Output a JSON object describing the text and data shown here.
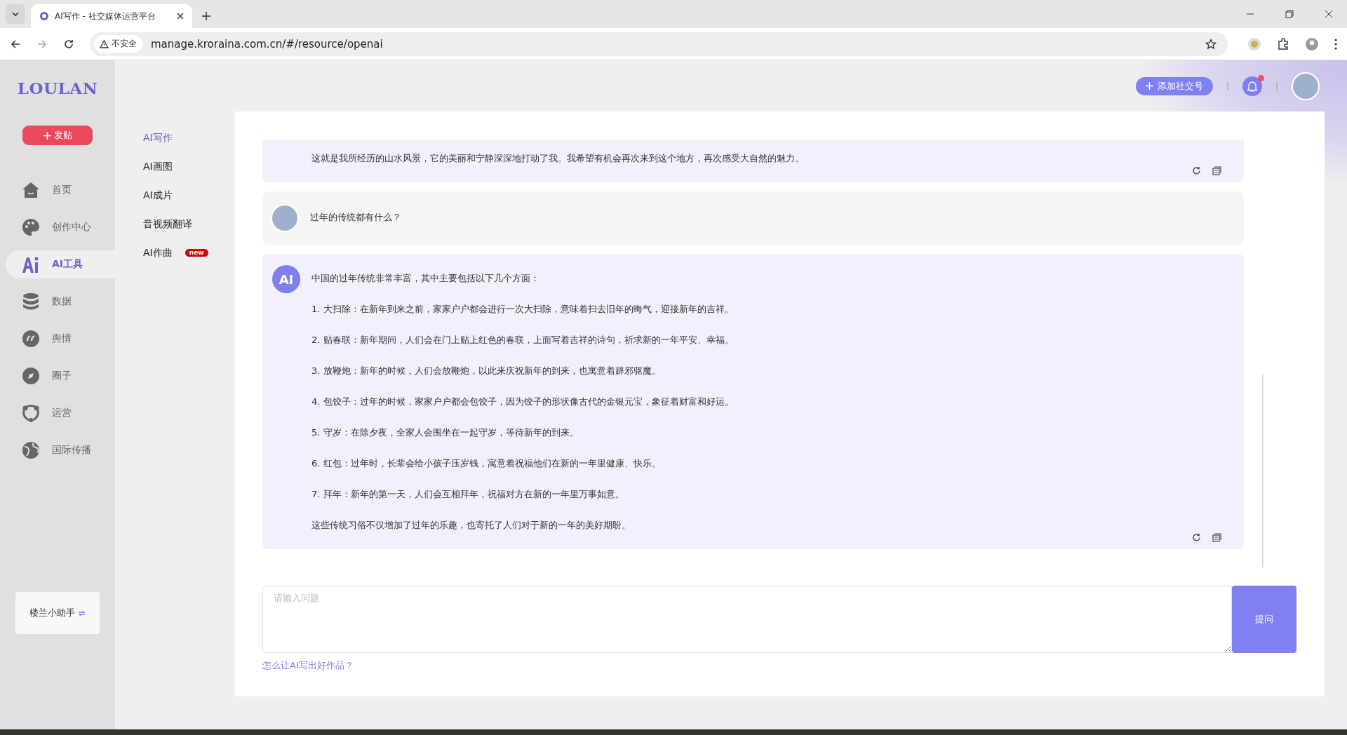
{
  "browser": {
    "tab_title": "AI写作 - 社交媒体运营平台",
    "security": "不安全",
    "url": "manage.kroraina.com.cn/#/resource/openai"
  },
  "sidebar": {
    "logo": "LOULAN",
    "post_button": "发贴",
    "items": [
      {
        "label": "首页",
        "kind": "home",
        "selected": false
      },
      {
        "label": "创作中心",
        "kind": "palette",
        "selected": false
      },
      {
        "label": "AI工具",
        "kind": "ai",
        "selected": true
      },
      {
        "label": "数据",
        "kind": "database",
        "selected": false
      },
      {
        "label": "舆情",
        "kind": "quote",
        "selected": false
      },
      {
        "label": "圈子",
        "kind": "compass",
        "selected": false
      },
      {
        "label": "运营",
        "kind": "network",
        "selected": false
      },
      {
        "label": "国际传播",
        "kind": "globe",
        "selected": false
      }
    ],
    "assistant": "楼兰小助手"
  },
  "submenu": [
    {
      "label": "AI写作",
      "selected": true
    },
    {
      "label": "AI画图",
      "selected": false
    },
    {
      "label": "AI成片",
      "selected": false
    },
    {
      "label": "音视频翻译",
      "selected": false
    },
    {
      "label": "AI作曲",
      "selected": false,
      "badge": "new"
    }
  ],
  "header": {
    "add_account": "添加社交号",
    "notification_dot": true
  },
  "messages": [
    {
      "kind": "ai",
      "cut_off": true,
      "paragraphs": [
        "这就是我所经历的山水风景，它的美丽和宁静深深地打动了我。我希望有机会再次来到这个地方，再次感受大自然的魅力。"
      ]
    },
    {
      "kind": "user",
      "cut_off": false,
      "paragraphs": [
        "过年的传统都有什么？"
      ]
    },
    {
      "kind": "ai",
      "cut_off": false,
      "avatar_text": "AI",
      "paragraphs": [
        "中国的过年传统非常丰富，其中主要包括以下几个方面：",
        "1. 大扫除：在新年到来之前，家家户户都会进行一次大扫除，意味着扫去旧年的晦气，迎接新年的吉祥。",
        "2. 贴春联：新年期间，人们会在门上贴上红色的春联，上面写着吉祥的诗句，祈求新的一年平安、幸福。",
        "3. 放鞭炮：新年的时候，人们会放鞭炮，以此来庆祝新年的到来，也寓意着辟邪驱魔。",
        "4. 包饺子：过年的时候，家家户户都会包饺子，因为饺子的形状像古代的金银元宝，象征着财富和好运。",
        "5. 守岁：在除夕夜，全家人会围坐在一起守岁，等待新年的到来。",
        "6. 红包：过年时，长辈会给小孩子压岁钱，寓意着祝福他们在新的一年里健康、快乐。",
        "7. 拜年：新年的第一天，人们会互相拜年，祝福对方在新的一年里万事如意。",
        "这些传统习俗不仅增加了过年的乐趣，也寄托了人们对于新的一年的美好期盼。"
      ]
    }
  ],
  "input": {
    "placeholder": "请输入问题",
    "submit": "提问",
    "help_link": "怎么让AI写出好作品？"
  }
}
